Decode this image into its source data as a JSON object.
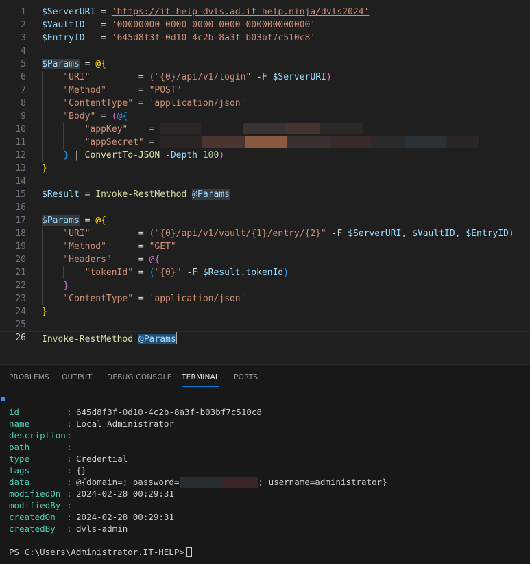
{
  "editor": {
    "lines": [
      {
        "n": "1",
        "segs": [
          [
            "t-var",
            "$ServerURI"
          ],
          [
            "t-op",
            " = "
          ],
          [
            "t-str t-link",
            "'https://it-help-dvls.ad.it-help.ninja/dvls2024'"
          ]
        ]
      },
      {
        "n": "2",
        "segs": [
          [
            "t-var",
            "$VaultID"
          ],
          [
            "t-op",
            "   = "
          ],
          [
            "t-str",
            "'00000000-0000-0000-0000-000000000000'"
          ]
        ]
      },
      {
        "n": "3",
        "segs": [
          [
            "t-var",
            "$EntryID"
          ],
          [
            "t-op",
            "   = "
          ],
          [
            "t-str",
            "'645d8f3f-0d10-4c2b-8a3f-b03bf7c510c8'"
          ]
        ]
      },
      {
        "n": "4",
        "segs": []
      },
      {
        "n": "5",
        "segs": [
          [
            "t-var hl-soft",
            "$Params"
          ],
          [
            "t-op",
            " = "
          ],
          [
            "t-br1",
            "@{"
          ]
        ]
      },
      {
        "n": "6",
        "segs": [
          [
            "t-op",
            "    "
          ],
          [
            "t-str",
            "\"URI\""
          ],
          [
            "t-op",
            "         = "
          ],
          [
            "t-br2",
            "("
          ],
          [
            "t-str",
            "\"{0}/api/v1/login\""
          ],
          [
            "t-op",
            " -F "
          ],
          [
            "t-var",
            "$ServerURI"
          ],
          [
            "t-br2",
            ")"
          ]
        ]
      },
      {
        "n": "7",
        "segs": [
          [
            "t-op",
            "    "
          ],
          [
            "t-str",
            "\"Method\""
          ],
          [
            "t-op",
            "      = "
          ],
          [
            "t-str",
            "\"POST\""
          ]
        ]
      },
      {
        "n": "8",
        "segs": [
          [
            "t-op",
            "    "
          ],
          [
            "t-str",
            "\"ContentType\""
          ],
          [
            "t-op",
            " = "
          ],
          [
            "t-str",
            "'application/json'"
          ]
        ]
      },
      {
        "n": "9",
        "segs": [
          [
            "t-op",
            "    "
          ],
          [
            "t-str",
            "\"Body\""
          ],
          [
            "t-op",
            " = "
          ],
          [
            "t-br2",
            "("
          ],
          [
            "t-br3",
            "@{"
          ]
        ]
      },
      {
        "n": "10",
        "segs": [
          [
            "t-op",
            "        "
          ],
          [
            "t-str",
            "\"appKey\""
          ],
          [
            "t-op",
            "    = "
          ]
        ],
        "blur": [
          [
            "#2d2424",
            60
          ],
          [
            "#1f1f1f",
            62
          ],
          [
            "#3a3232",
            62
          ],
          [
            "#453430",
            50
          ],
          [
            "#2a2725",
            62
          ]
        ]
      },
      {
        "n": "11",
        "segs": [
          [
            "t-op",
            "        "
          ],
          [
            "t-str",
            "\"appSecret\""
          ],
          [
            "t-op",
            " = "
          ]
        ],
        "blur": [
          [
            "#2a2424",
            62
          ],
          [
            "#4a3530",
            62
          ],
          [
            "#8a5a40",
            62
          ],
          [
            "#3a3030",
            62
          ],
          [
            "#3a2a2a",
            60
          ],
          [
            "#2a2a2a",
            50
          ],
          [
            "#2a3238",
            60
          ],
          [
            "#2a2626",
            48
          ]
        ]
      },
      {
        "n": "12",
        "segs": [
          [
            "t-op",
            "    "
          ],
          [
            "t-br3",
            "}"
          ],
          [
            "t-op",
            " | "
          ],
          [
            "t-fn",
            "ConvertTo-JSON"
          ],
          [
            "t-op",
            " "
          ],
          [
            "t-param",
            "-Depth"
          ],
          [
            "t-op",
            " "
          ],
          [
            "t-num",
            "100"
          ],
          [
            "t-br2",
            ")"
          ]
        ]
      },
      {
        "n": "13",
        "segs": [
          [
            "t-br1",
            "}"
          ]
        ]
      },
      {
        "n": "14",
        "segs": []
      },
      {
        "n": "15",
        "segs": [
          [
            "t-var",
            "$Result"
          ],
          [
            "t-op",
            " = "
          ],
          [
            "t-fn",
            "Invoke-RestMethod"
          ],
          [
            "t-op",
            " "
          ],
          [
            "t-var hl-soft",
            "@Params"
          ]
        ]
      },
      {
        "n": "16",
        "segs": []
      },
      {
        "n": "17",
        "segs": [
          [
            "t-var hl-soft",
            "$Params"
          ],
          [
            "t-op",
            " = "
          ],
          [
            "t-br1",
            "@{"
          ]
        ]
      },
      {
        "n": "18",
        "segs": [
          [
            "t-op",
            "    "
          ],
          [
            "t-str",
            "\"URI\""
          ],
          [
            "t-op",
            "         = "
          ],
          [
            "t-br2",
            "("
          ],
          [
            "t-str",
            "\"{0}/api/v1/vault/{1}/entry/{2}\""
          ],
          [
            "t-op",
            " -F "
          ],
          [
            "t-var",
            "$ServerURI"
          ],
          [
            "t-op",
            ", "
          ],
          [
            "t-var",
            "$VaultID"
          ],
          [
            "t-op",
            ", "
          ],
          [
            "t-var",
            "$EntryID"
          ],
          [
            "t-br2",
            ")"
          ]
        ]
      },
      {
        "n": "19",
        "segs": [
          [
            "t-op",
            "    "
          ],
          [
            "t-str",
            "\"Method\""
          ],
          [
            "t-op",
            "      = "
          ],
          [
            "t-str",
            "\"GET\""
          ]
        ]
      },
      {
        "n": "20",
        "segs": [
          [
            "t-op",
            "    "
          ],
          [
            "t-str",
            "\"Headers\""
          ],
          [
            "t-op",
            "     = "
          ],
          [
            "t-br2",
            "@{"
          ]
        ]
      },
      {
        "n": "21",
        "segs": [
          [
            "t-op",
            "        "
          ],
          [
            "t-str",
            "\"tokenId\""
          ],
          [
            "t-op",
            " = "
          ],
          [
            "t-br3",
            "("
          ],
          [
            "t-str",
            "\"{0}\""
          ],
          [
            "t-op",
            " -F "
          ],
          [
            "t-var",
            "$Result"
          ],
          [
            "t-op",
            "."
          ],
          [
            "t-var",
            "tokenId"
          ],
          [
            "t-br3",
            ")"
          ]
        ]
      },
      {
        "n": "22",
        "segs": [
          [
            "t-op",
            "    "
          ],
          [
            "t-br2",
            "}"
          ]
        ]
      },
      {
        "n": "23",
        "segs": [
          [
            "t-op",
            "    "
          ],
          [
            "t-str",
            "\"ContentType\""
          ],
          [
            "t-op",
            " = "
          ],
          [
            "t-str",
            "'application/json'"
          ]
        ]
      },
      {
        "n": "24",
        "segs": [
          [
            "t-br1",
            "}"
          ]
        ]
      },
      {
        "n": "25",
        "segs": []
      },
      {
        "n": "26",
        "segs": [
          [
            "t-fn",
            "Invoke-RestMethod"
          ],
          [
            "t-op",
            " "
          ],
          [
            "t-var hl",
            "@Params"
          ]
        ],
        "current": true
      }
    ]
  },
  "panel": {
    "tabs": [
      {
        "label": "PROBLEMS",
        "active": false
      },
      {
        "label": "OUTPUT",
        "active": false
      },
      {
        "label": "DEBUG CONSOLE",
        "active": false
      },
      {
        "label": "TERMINAL",
        "active": true
      },
      {
        "label": "PORTS",
        "active": false
      }
    ],
    "output": [
      {
        "key": "id",
        "value": "645d8f3f-0d10-4c2b-8a3f-b03bf7c510c8"
      },
      {
        "key": "name",
        "value": "Local Administrator"
      },
      {
        "key": "description",
        "value": ""
      },
      {
        "key": "path",
        "value": ""
      },
      {
        "key": "type",
        "value": "Credential"
      },
      {
        "key": "tags",
        "value": "{}"
      },
      {
        "key": "data",
        "value_before": "@{domain=; password=",
        "value_after": "; username=administrator}"
      },
      {
        "key": "modifiedOn",
        "value": "2024-02-28 00:29:31"
      },
      {
        "key": "modifiedBy",
        "value": ""
      },
      {
        "key": "createdOn",
        "value": "2024-02-28 00:29:31"
      },
      {
        "key": "createdBy",
        "value": "dvls-admin"
      }
    ],
    "prompt": "PS C:\\Users\\Administrator.IT-HELP>"
  },
  "colors": {
    "background": "#1f1f1f",
    "panel_background": "#181818",
    "accent": "#0078d4",
    "terminal_key": "#4ec9b0"
  }
}
